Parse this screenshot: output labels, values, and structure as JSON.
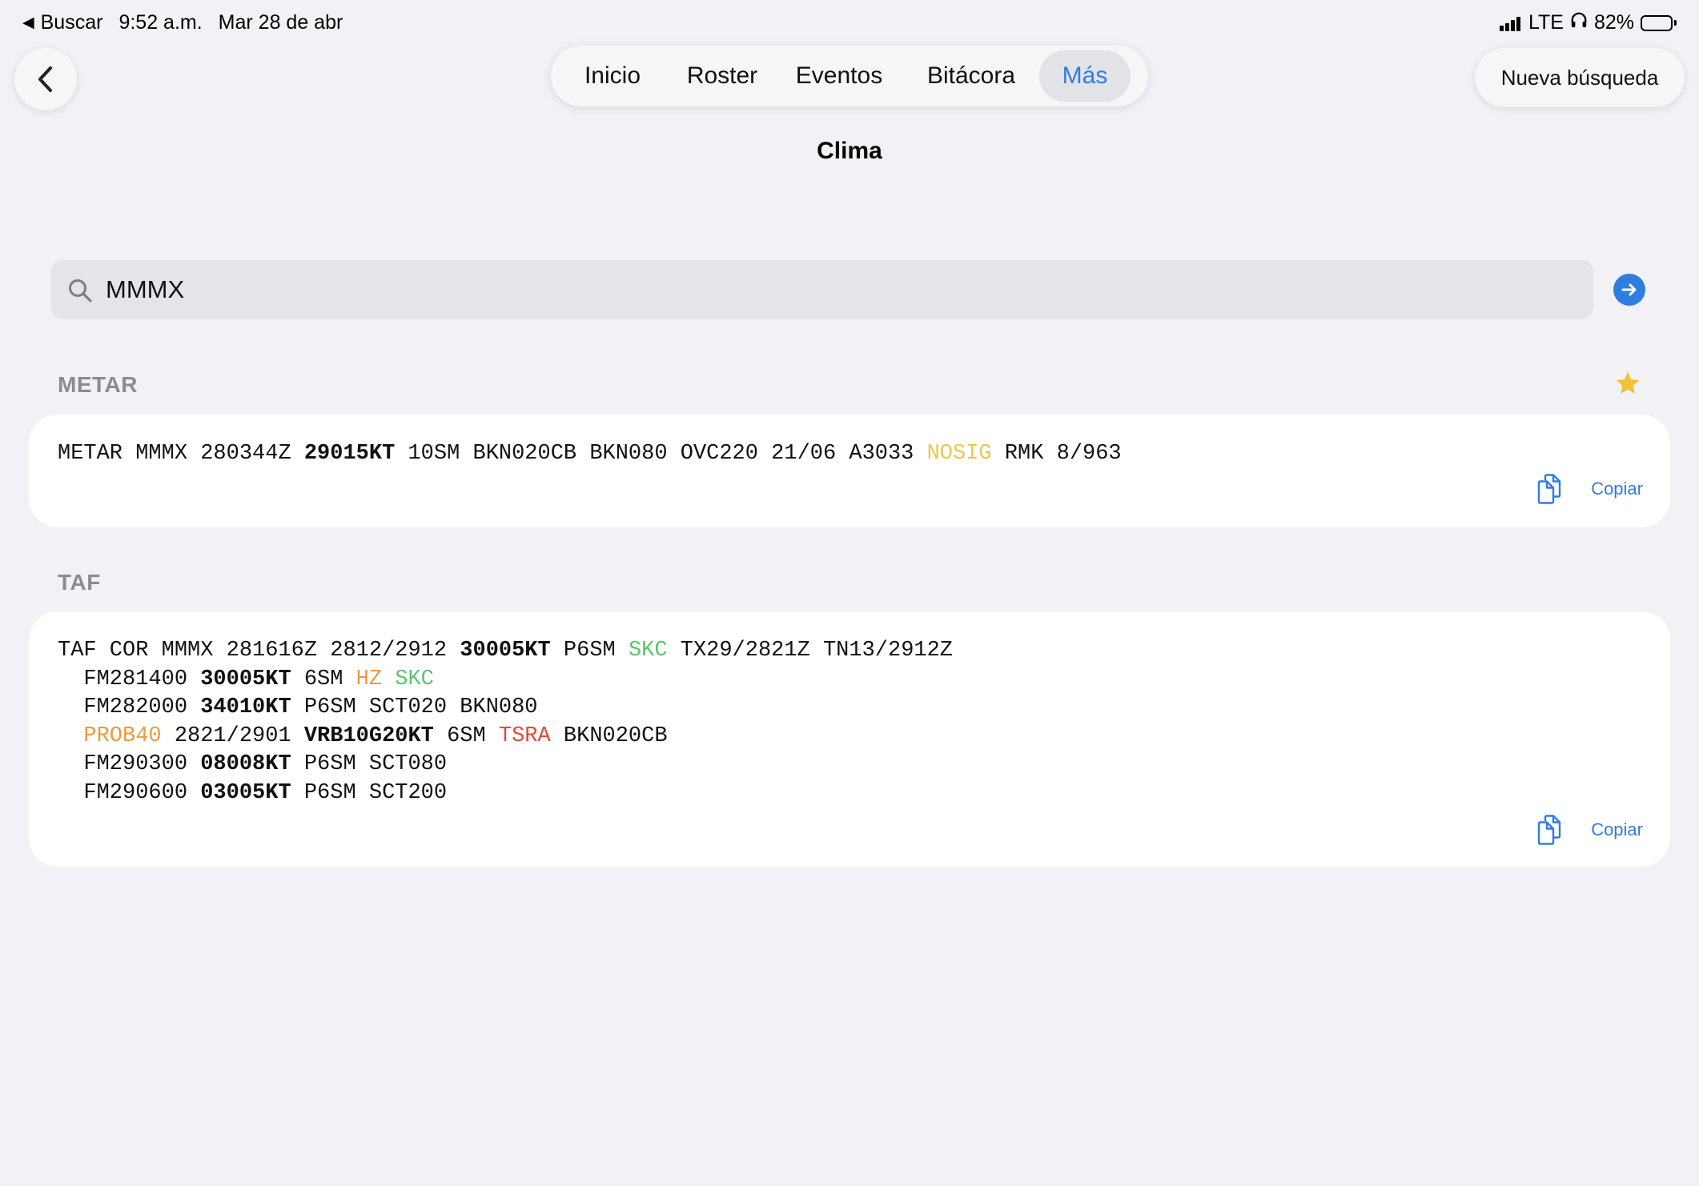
{
  "status_bar": {
    "back_app": "Buscar",
    "time": "9:52 a.m.",
    "date": "Mar 28 de abr",
    "network": "LTE",
    "battery": "82%",
    "battery_level": 0.82
  },
  "nav": {
    "tabs": [
      {
        "label": "Inicio"
      },
      {
        "label": "Roster"
      },
      {
        "label": "Eventos"
      },
      {
        "label": "Bitácora"
      },
      {
        "label": "Más",
        "active": true
      }
    ],
    "new_search": "Nueva búsqueda"
  },
  "page_title": "Clima",
  "search": {
    "value": "MMMX"
  },
  "metar": {
    "label": "METAR",
    "favorite": true,
    "lines": [
      [
        {
          "t": "METAR MMMX 280344Z "
        },
        {
          "t": "29015KT",
          "s": "bold"
        },
        {
          "t": " 10SM BKN020CB BKN080 OVC220 21/06 A3033 "
        },
        {
          "t": "NOSIG",
          "s": "yellow"
        },
        {
          "t": " RMK 8/963"
        }
      ]
    ],
    "copy_label": "Copiar"
  },
  "taf": {
    "label": "TAF",
    "lines": [
      [
        {
          "t": "TAF COR MMMX 281616Z 2812/2912 "
        },
        {
          "t": "30005KT",
          "s": "bold"
        },
        {
          "t": " P6SM "
        },
        {
          "t": "SKC",
          "s": "green"
        },
        {
          "t": " TX29/2821Z TN13/2912Z"
        }
      ],
      [
        {
          "t": "  FM281400 "
        },
        {
          "t": "30005KT",
          "s": "bold"
        },
        {
          "t": " 6SM "
        },
        {
          "t": "HZ",
          "s": "orange"
        },
        {
          "t": " "
        },
        {
          "t": "SKC",
          "s": "green"
        }
      ],
      [
        {
          "t": "  FM282000 "
        },
        {
          "t": "34010KT",
          "s": "bold"
        },
        {
          "t": " P6SM SCT020 BKN080"
        }
      ],
      [
        {
          "t": "  "
        },
        {
          "t": "PROB40",
          "s": "orange"
        },
        {
          "t": " 2821/2901 "
        },
        {
          "t": "VRB10G20KT",
          "s": "bold"
        },
        {
          "t": " 6SM "
        },
        {
          "t": "TSRA",
          "s": "red"
        },
        {
          "t": " BKN020CB"
        }
      ],
      [
        {
          "t": "  FM290300 "
        },
        {
          "t": "08008KT",
          "s": "bold"
        },
        {
          "t": " P6SM SCT080"
        }
      ],
      [
        {
          "t": "  FM290600 "
        },
        {
          "t": "03005KT",
          "s": "bold"
        },
        {
          "t": " P6SM SCT200"
        }
      ]
    ],
    "copy_label": "Copiar"
  },
  "icons": {
    "back": "chevron-left-icon",
    "search": "magnifier-icon",
    "go": "arrow-right-circle-icon",
    "favorite": "star-icon",
    "copy": "copy-document-icon"
  },
  "colors": {
    "accent": "#2f7ddf",
    "nosig": "#e9c84a",
    "skc": "#5cc46b",
    "caution": "#ec9a3f",
    "danger": "#e04a3b",
    "star": "#f2c230"
  }
}
